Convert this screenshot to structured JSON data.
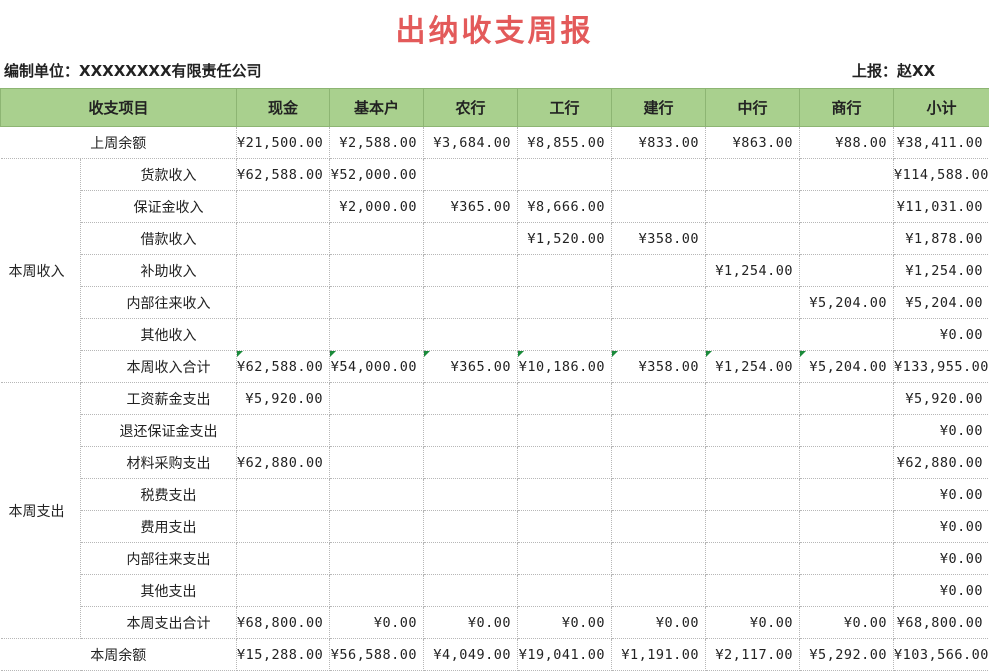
{
  "title": "出纳收支周报",
  "unit": "编制单位：XXXXXXXX有限责任公司",
  "reporter": "上报：赵XX",
  "headers": [
    "收支项目",
    "现金",
    "基本户",
    "农行",
    "工行",
    "建行",
    "中行",
    "商行",
    "小计"
  ],
  "last_week": {
    "label": "上周余额",
    "values": [
      "¥21,500.00",
      "¥2,588.00",
      "¥3,684.00",
      "¥8,855.00",
      "¥833.00",
      "¥863.00",
      "¥88.00",
      "¥38,411.00"
    ]
  },
  "income": {
    "group": "本周收入",
    "rows": [
      {
        "label": "货款收入",
        "values": [
          "¥62,588.00",
          "¥52,000.00",
          "",
          "",
          "",
          "",
          "",
          "¥114,588.00"
        ]
      },
      {
        "label": "保证金收入",
        "values": [
          "",
          "¥2,000.00",
          "¥365.00",
          "¥8,666.00",
          "",
          "",
          "",
          "¥11,031.00"
        ]
      },
      {
        "label": "借款收入",
        "values": [
          "",
          "",
          "",
          "¥1,520.00",
          "¥358.00",
          "",
          "",
          "¥1,878.00"
        ]
      },
      {
        "label": "补助收入",
        "values": [
          "",
          "",
          "",
          "",
          "",
          "¥1,254.00",
          "",
          "¥1,254.00"
        ]
      },
      {
        "label": "内部往来收入",
        "values": [
          "",
          "",
          "",
          "",
          "",
          "",
          "¥5,204.00",
          "¥5,204.00"
        ]
      },
      {
        "label": "其他收入",
        "values": [
          "",
          "",
          "",
          "",
          "",
          "",
          "",
          "¥0.00"
        ]
      },
      {
        "label": "本周收入合计",
        "values": [
          "¥62,588.00",
          "¥54,000.00",
          "¥365.00",
          "¥10,186.00",
          "¥358.00",
          "¥1,254.00",
          "¥5,204.00",
          "¥133,955.00"
        ]
      }
    ]
  },
  "expense": {
    "group": "本周支出",
    "rows": [
      {
        "label": "工资薪金支出",
        "values": [
          "¥5,920.00",
          "",
          "",
          "",
          "",
          "",
          "",
          "¥5,920.00"
        ]
      },
      {
        "label": "退还保证金支出",
        "values": [
          "",
          "",
          "",
          "",
          "",
          "",
          "",
          "¥0.00"
        ]
      },
      {
        "label": "材料采购支出",
        "values": [
          "¥62,880.00",
          "",
          "",
          "",
          "",
          "",
          "",
          "¥62,880.00"
        ]
      },
      {
        "label": "税费支出",
        "values": [
          "",
          "",
          "",
          "",
          "",
          "",
          "",
          "¥0.00"
        ]
      },
      {
        "label": "费用支出",
        "values": [
          "",
          "",
          "",
          "",
          "",
          "",
          "",
          "¥0.00"
        ]
      },
      {
        "label": "内部往来支出",
        "values": [
          "",
          "",
          "",
          "",
          "",
          "",
          "",
          "¥0.00"
        ]
      },
      {
        "label": "其他支出",
        "values": [
          "",
          "",
          "",
          "",
          "",
          "",
          "",
          "¥0.00"
        ]
      },
      {
        "label": "本周支出合计",
        "values": [
          "¥68,800.00",
          "¥0.00",
          "¥0.00",
          "¥0.00",
          "¥0.00",
          "¥0.00",
          "¥0.00",
          "¥68,800.00"
        ]
      }
    ]
  },
  "this_week": {
    "label": "本周余额",
    "values": [
      "¥15,288.00",
      "¥56,588.00",
      "¥4,049.00",
      "¥19,041.00",
      "¥1,191.00",
      "¥2,117.00",
      "¥5,292.00",
      "¥103,566.00"
    ]
  }
}
